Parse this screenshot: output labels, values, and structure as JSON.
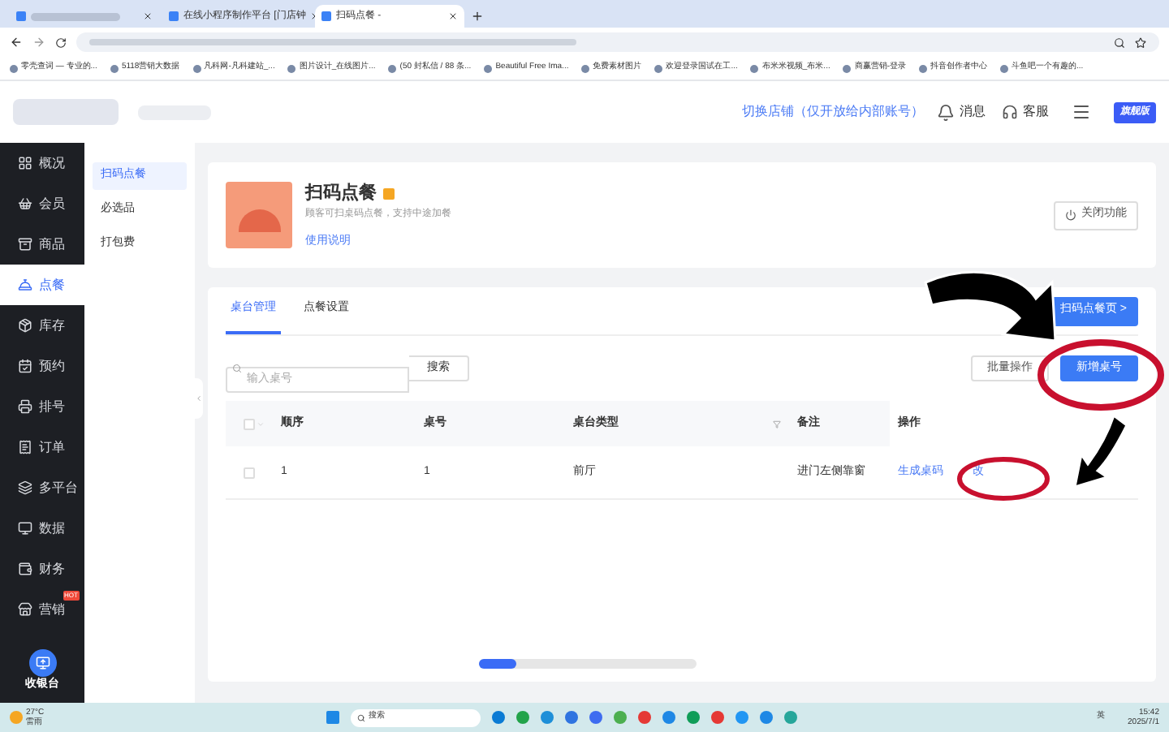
{
  "browser": {
    "tabs": [
      {
        "selected": false
      },
      {
        "title": "在线小程序制作平台 [门店钟",
        "selected": false
      },
      {
        "title": "扫码点餐 -",
        "selected": true
      }
    ],
    "bookmarks": [
      "零壳查词 — 专业的...",
      "5118营销大数据",
      "凡科网-凡科建站_...",
      "图片设计_在线图片...",
      "(50 封私信 / 88 条...",
      "Beautiful Free Ima...",
      "免费素材图片",
      "欢迎登录国试在工...",
      "布米米视频_布米...",
      "商赢营销-登录",
      "抖音创作者中心",
      "斗鱼吧一个有趣的..."
    ]
  },
  "header": {
    "switch_store": "切换店铺（仅开放给内部账号）",
    "messages": "消息",
    "service": "客服",
    "badge": "旗舰版"
  },
  "sidebar": {
    "items": [
      {
        "label": "概况",
        "selected": false
      },
      {
        "label": "会员",
        "selected": false
      },
      {
        "label": "商品",
        "selected": false
      },
      {
        "label": "点餐",
        "selected": true
      },
      {
        "label": "库存",
        "selected": false
      },
      {
        "label": "预约",
        "selected": false
      },
      {
        "label": "排号",
        "selected": false
      },
      {
        "label": "订单",
        "selected": false
      },
      {
        "label": "多平台",
        "selected": false
      },
      {
        "label": "数据",
        "selected": false
      },
      {
        "label": "财务",
        "selected": false
      },
      {
        "label": "营销",
        "selected": false,
        "tag": "HOT"
      }
    ],
    "cashier": "收银台"
  },
  "subnav": [
    {
      "label": "扫码点餐",
      "selected": true
    },
    {
      "label": "必选品",
      "selected": false
    },
    {
      "label": "打包费",
      "selected": false
    }
  ],
  "feature": {
    "title": "扫码点餐",
    "description": "顾客可扫桌码点餐，支持中途加餐",
    "help_link": "使用说明",
    "close_button": "关闭功能"
  },
  "tabs": [
    {
      "label": "桌台管理",
      "selected": true
    },
    {
      "label": "点餐设置",
      "selected": false
    }
  ],
  "open_page_button": "扫码点餐页 >",
  "search": {
    "placeholder": "输入桌号",
    "button": "搜索"
  },
  "batch_button": "批量操作",
  "add_button": "新增桌号",
  "table": {
    "select_all_checked": false,
    "columns": [
      "顺序",
      "桌号",
      "桌台类型",
      "备注",
      "操作"
    ],
    "rows": [
      {
        "checked": false,
        "cells": [
          "1",
          "1",
          "前厅",
          "进门左侧靠窗"
        ],
        "actions": [
          "生成桌码",
          "改"
        ]
      }
    ]
  },
  "progress": {
    "level": 0.17
  },
  "taskbar": {
    "weather": "27°C",
    "weather_desc": "雷雨",
    "search": "搜索",
    "lang": "英",
    "time": "15:42",
    "date": "2025/7/1"
  }
}
